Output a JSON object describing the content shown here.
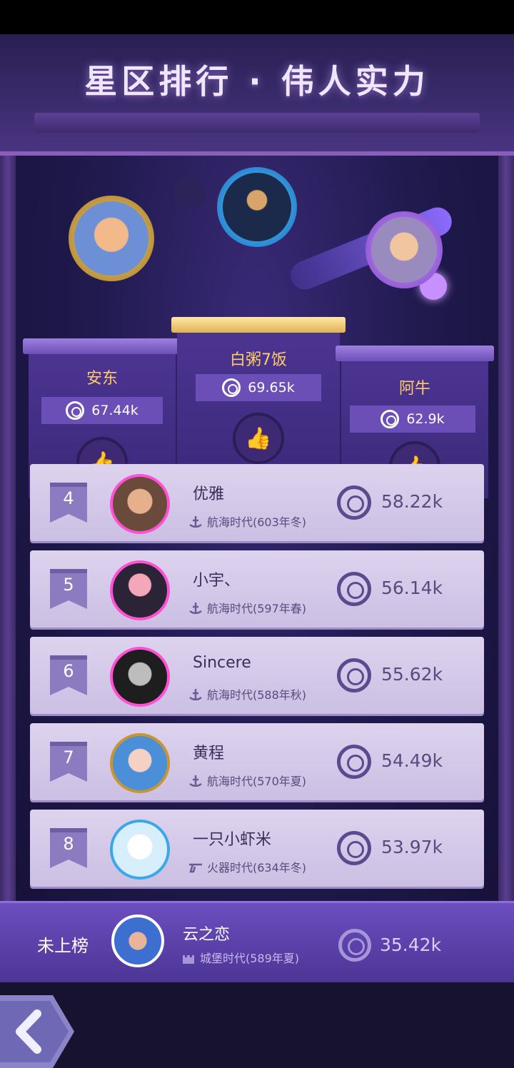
{
  "title": "星区排行 · 伟人实力",
  "podium": [
    {
      "rank": 1,
      "name": "白粥7饭",
      "score": "69.65k"
    },
    {
      "rank": 2,
      "name": "安东",
      "score": "67.44k"
    },
    {
      "rank": 3,
      "name": "阿牛",
      "score": "62.9k"
    }
  ],
  "ranking": [
    {
      "rank": "4",
      "name": "优雅",
      "era": "航海时代(603年冬)",
      "score": "58.22k",
      "era_icon": "sail-anchor-icon"
    },
    {
      "rank": "5",
      "name": "小宇、",
      "era": "航海时代(597年春)",
      "score": "56.14k",
      "era_icon": "sail-anchor-icon"
    },
    {
      "rank": "6",
      "name": "Sincere",
      "era": "航海时代(588年秋)",
      "score": "55.62k",
      "era_icon": "sail-anchor-icon"
    },
    {
      "rank": "7",
      "name": "黄程",
      "era": "航海时代(570年夏)",
      "score": "54.49k",
      "era_icon": "sail-anchor-icon"
    },
    {
      "rank": "8",
      "name": "一只小虾米",
      "era": "火器时代(634年冬)",
      "score": "53.97k",
      "era_icon": "musket-icon"
    }
  ],
  "me": {
    "label": "未上榜",
    "name": "云之恋",
    "era": "城堡时代(589年夏)",
    "score": "35.42k",
    "era_icon": "castle-icon"
  },
  "colors": {
    "podium_name": "#ffcc66",
    "ring_highlight": "#ff4fd2",
    "row_bg": "#d6cbeb",
    "my_row_bg": "#5d44aa"
  }
}
